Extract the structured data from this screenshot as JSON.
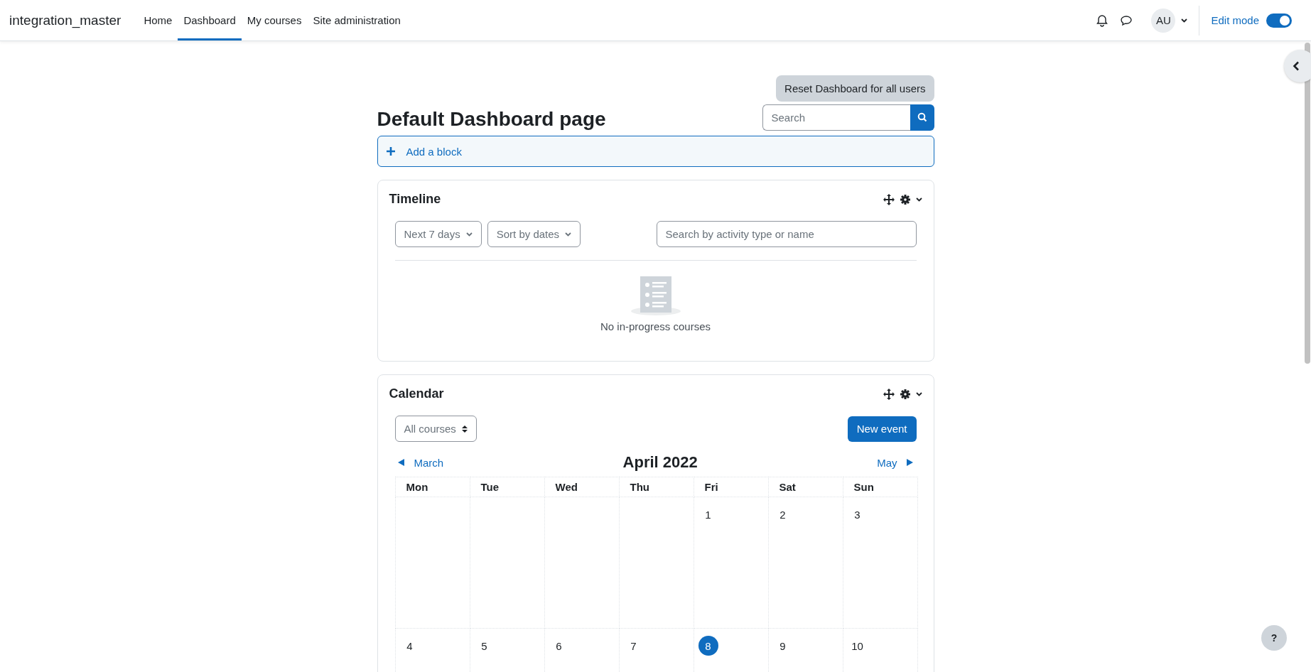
{
  "site_name": "integration_master",
  "nav": [
    {
      "label": "Home",
      "selected": false
    },
    {
      "label": "Dashboard",
      "selected": true
    },
    {
      "label": "My courses",
      "selected": false
    },
    {
      "label": "Site administration",
      "selected": false
    }
  ],
  "user": {
    "initials": "AU"
  },
  "edit_mode": {
    "label": "Edit mode",
    "on": true
  },
  "reset_button": "Reset Dashboard for all users",
  "page_title": "Default Dashboard page",
  "search": {
    "placeholder": "Search"
  },
  "add_block": "Add a block",
  "timeline": {
    "title": "Timeline",
    "filter": "Next 7 days",
    "sort": "Sort by dates",
    "search_placeholder": "Search by activity type or name",
    "empty_message": "No in-progress courses"
  },
  "calendar": {
    "title": "Calendar",
    "course_filter": "All courses",
    "new_event": "New event",
    "prev_month": "March",
    "month": "April 2022",
    "next_month": "May",
    "day_names": [
      "Mon",
      "Tue",
      "Wed",
      "Thu",
      "Fri",
      "Sat",
      "Sun"
    ],
    "weeks": [
      [
        {
          "day": "1",
          "today": false
        },
        {
          "day": "2",
          "today": false
        },
        {
          "day": "3",
          "today": false
        }
      ],
      [
        {
          "day": "4",
          "today": false
        },
        {
          "day": "5",
          "today": false
        },
        {
          "day": "6",
          "today": false
        },
        {
          "day": "7",
          "today": false
        },
        {
          "day": "8",
          "today": true
        },
        {
          "day": "9",
          "today": false
        },
        {
          "day": "10",
          "today": false
        }
      ]
    ]
  },
  "help_button": "?"
}
